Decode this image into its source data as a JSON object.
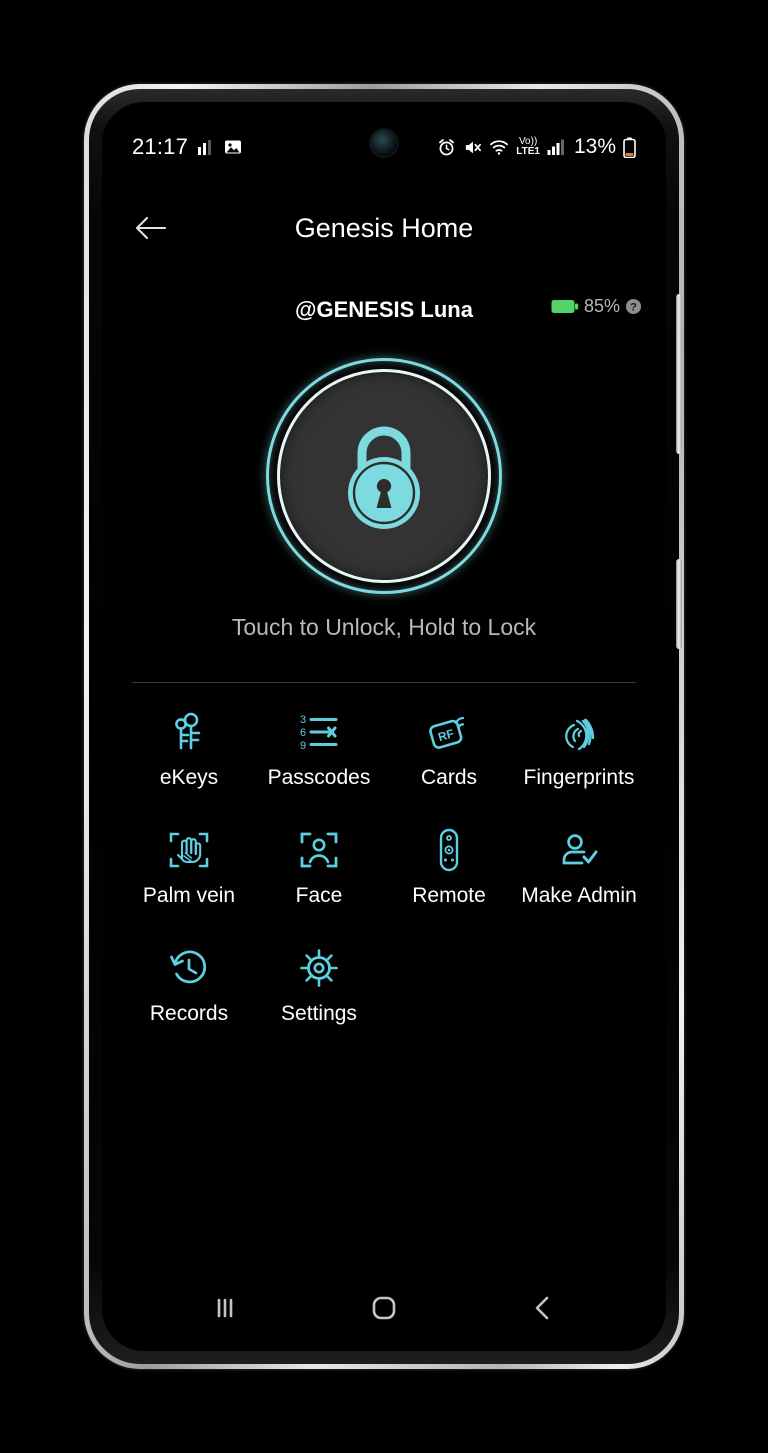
{
  "status_bar": {
    "clock": "21:17",
    "battery_text": "13%",
    "left_icons": [
      "signal-bars-icon",
      "image-icon"
    ],
    "right_icons": [
      "alarm-icon",
      "mute-icon",
      "wifi-icon",
      "volte-lte1-icon",
      "cellular-signal-icon",
      "battery-low-icon"
    ],
    "volte_label": "Vo))",
    "lte_label": "LTE1"
  },
  "app_bar": {
    "back_icon": "arrow-left-icon",
    "title": "Genesis Home"
  },
  "device": {
    "name": "@GENESIS Luna",
    "battery_text": "85%",
    "battery_icon": "battery-full-green-icon",
    "help_icon": "question-mark-circle-icon"
  },
  "lock": {
    "icon": "padlock-locked-icon",
    "hint": "Touch to Unlock, Hold to Lock",
    "accent_color": "#7ddbe0",
    "ring_color": "#e9f6f7",
    "face_color": "#333333"
  },
  "features": [
    {
      "label": "eKeys",
      "icon": "keys-icon"
    },
    {
      "label": "Passcodes",
      "icon": "passcode-list-icon"
    },
    {
      "label": "Cards",
      "icon": "rf-card-icon"
    },
    {
      "label": "Fingerprints",
      "icon": "fingerprint-icon"
    },
    {
      "label": "Palm vein",
      "icon": "palm-scan-icon"
    },
    {
      "label": "Face",
      "icon": "face-scan-icon"
    },
    {
      "label": "Remote",
      "icon": "remote-control-icon"
    },
    {
      "label": "Make Admin",
      "icon": "person-check-icon"
    },
    {
      "label": "Records",
      "icon": "history-clock-icon"
    },
    {
      "label": "Settings",
      "icon": "gear-icon"
    }
  ],
  "nav_bar": {
    "recents_icon": "recents-icon",
    "home_icon": "home-square-icon",
    "back_icon": "chevron-left-icon"
  },
  "colors": {
    "accent": "#7ddbe0",
    "background": "#000000",
    "text_primary": "#ffffff",
    "text_secondary": "#b9b9b9",
    "battery_green": "#53d36a"
  }
}
